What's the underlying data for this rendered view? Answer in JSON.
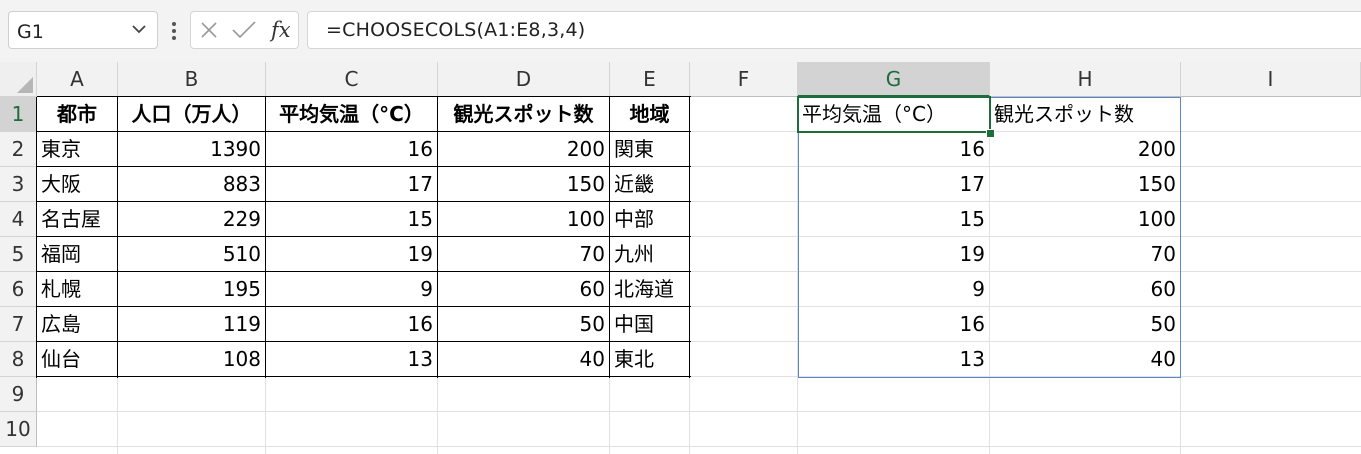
{
  "formula_bar": {
    "name_box": "G1",
    "fx_label": "fx",
    "formula": "=CHOOSECOLS(A1:E8,3,4)"
  },
  "columns": [
    "A",
    "B",
    "C",
    "D",
    "E",
    "F",
    "G",
    "H",
    "I"
  ],
  "rows": [
    "1",
    "2",
    "3",
    "4",
    "5",
    "6",
    "7",
    "8",
    "9",
    "10"
  ],
  "source_table": {
    "headers": [
      "都市",
      "人口（万人）",
      "平均気温（°C）",
      "観光スポット数",
      "地域"
    ],
    "rows": [
      [
        "東京",
        "1390",
        "16",
        "200",
        "関東"
      ],
      [
        "大阪",
        "883",
        "17",
        "150",
        "近畿"
      ],
      [
        "名古屋",
        "229",
        "15",
        "100",
        "中部"
      ],
      [
        "福岡",
        "510",
        "19",
        "70",
        "九州"
      ],
      [
        "札幌",
        "195",
        "9",
        "60",
        "北海道"
      ],
      [
        "広島",
        "119",
        "16",
        "50",
        "中国"
      ],
      [
        "仙台",
        "108",
        "13",
        "40",
        "東北"
      ]
    ]
  },
  "spill_result": {
    "headers": [
      "平均気温（°C）",
      "観光スポット数"
    ],
    "rows": [
      [
        "16",
        "200"
      ],
      [
        "17",
        "150"
      ],
      [
        "15",
        "100"
      ],
      [
        "19",
        "70"
      ],
      [
        "9",
        "60"
      ],
      [
        "16",
        "50"
      ],
      [
        "13",
        "40"
      ]
    ]
  },
  "selection": {
    "active_cell": "G1",
    "selected_column": "G",
    "selected_row": "1"
  },
  "colors": {
    "accent_green": "#1e6b3c",
    "spill_border": "#5b86c8"
  }
}
